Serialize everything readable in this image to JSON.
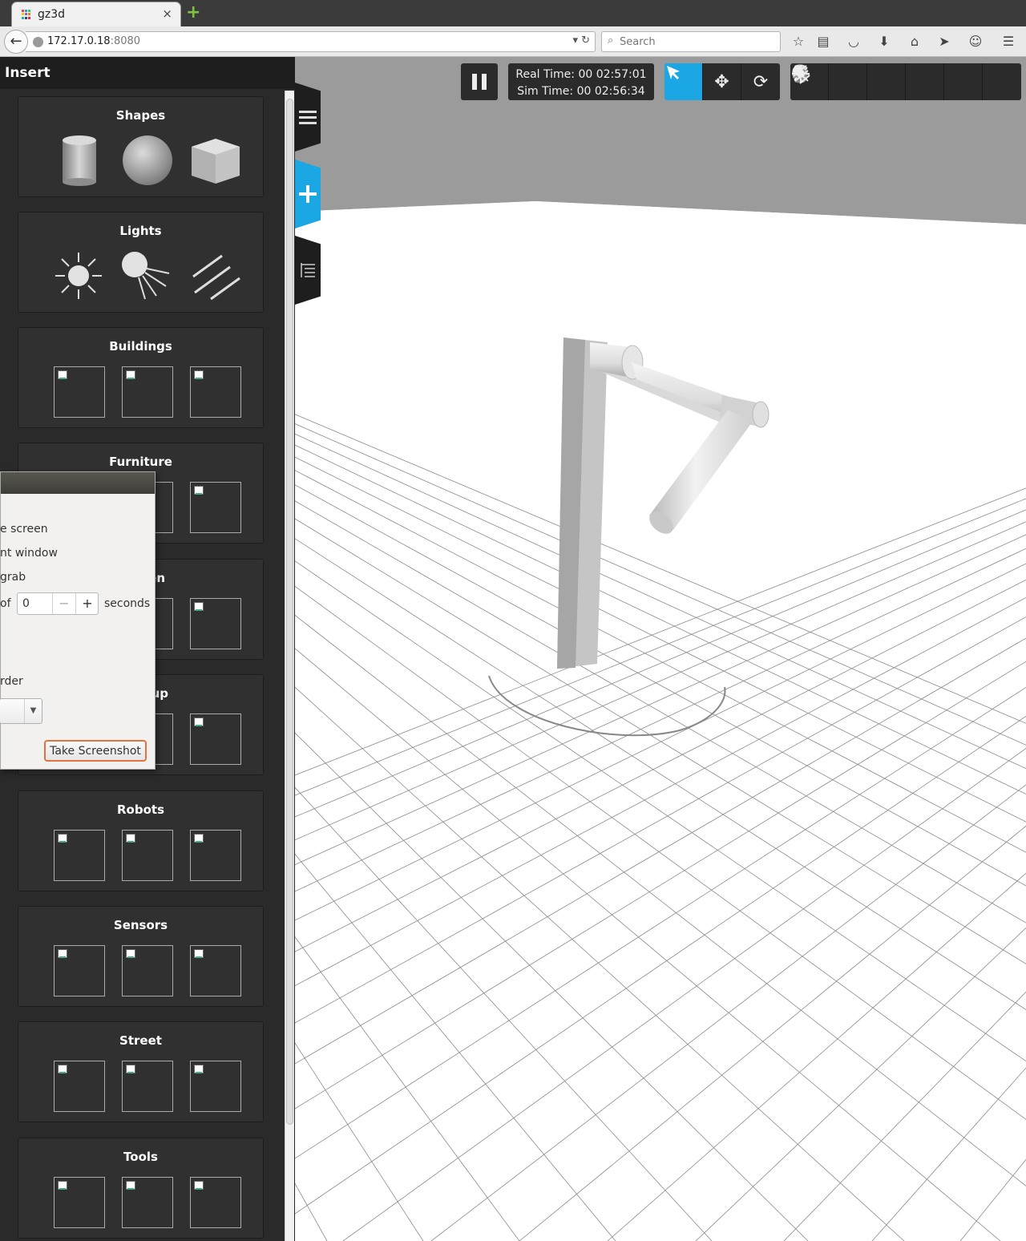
{
  "browser": {
    "tab_title": "gz3d",
    "tab_close": "×",
    "new_tab": "+",
    "url_host": "172.17.0.18",
    "url_port": ":8080",
    "search_placeholder": "Search",
    "favicon_colors": [
      "#e74c3c",
      "#3498db",
      "#2ecc71",
      "#f1c40f",
      "#9b59b6",
      "#e67e22",
      "#1abc9c",
      "#34495e",
      "#e91e63"
    ]
  },
  "toolbar": {
    "real_time_label": "Real Time: 00 02:57:01",
    "sim_time_label": "Sim Time: 00 02:56:34",
    "modes": [
      "select-mode",
      "translate-mode",
      "rotate-mode"
    ],
    "active_mode": "select-mode",
    "insert_items": [
      "box",
      "sphere",
      "cylinder",
      "point-light",
      "spot-light",
      "directional-light"
    ],
    "accent_color": "#1aa7e3"
  },
  "panel": {
    "title": "Insert",
    "categories": [
      {
        "title": "Shapes"
      },
      {
        "title": "Lights"
      },
      {
        "title": "Buildings"
      },
      {
        "title": "Furniture"
      },
      {
        "title": "Kitchen"
      },
      {
        "title": "Tabletop"
      },
      {
        "title": "Robots"
      },
      {
        "title": "Sensors"
      },
      {
        "title": "Street"
      },
      {
        "title": "Tools"
      }
    ],
    "visible_fragments": {
      "kitchen": "en",
      "tabletop": "up"
    }
  },
  "side_tabs": [
    "menu-tab",
    "insert-tab",
    "model-tree-tab"
  ],
  "dialog": {
    "line1": "e screen",
    "line2": "nt window",
    "line3": "grab",
    "delay_prefix": "of",
    "delay_value": "0",
    "delay_unit": "seconds",
    "border_label": "rder",
    "take_button": "Take Screenshot",
    "minus": "−",
    "plus": "+"
  }
}
